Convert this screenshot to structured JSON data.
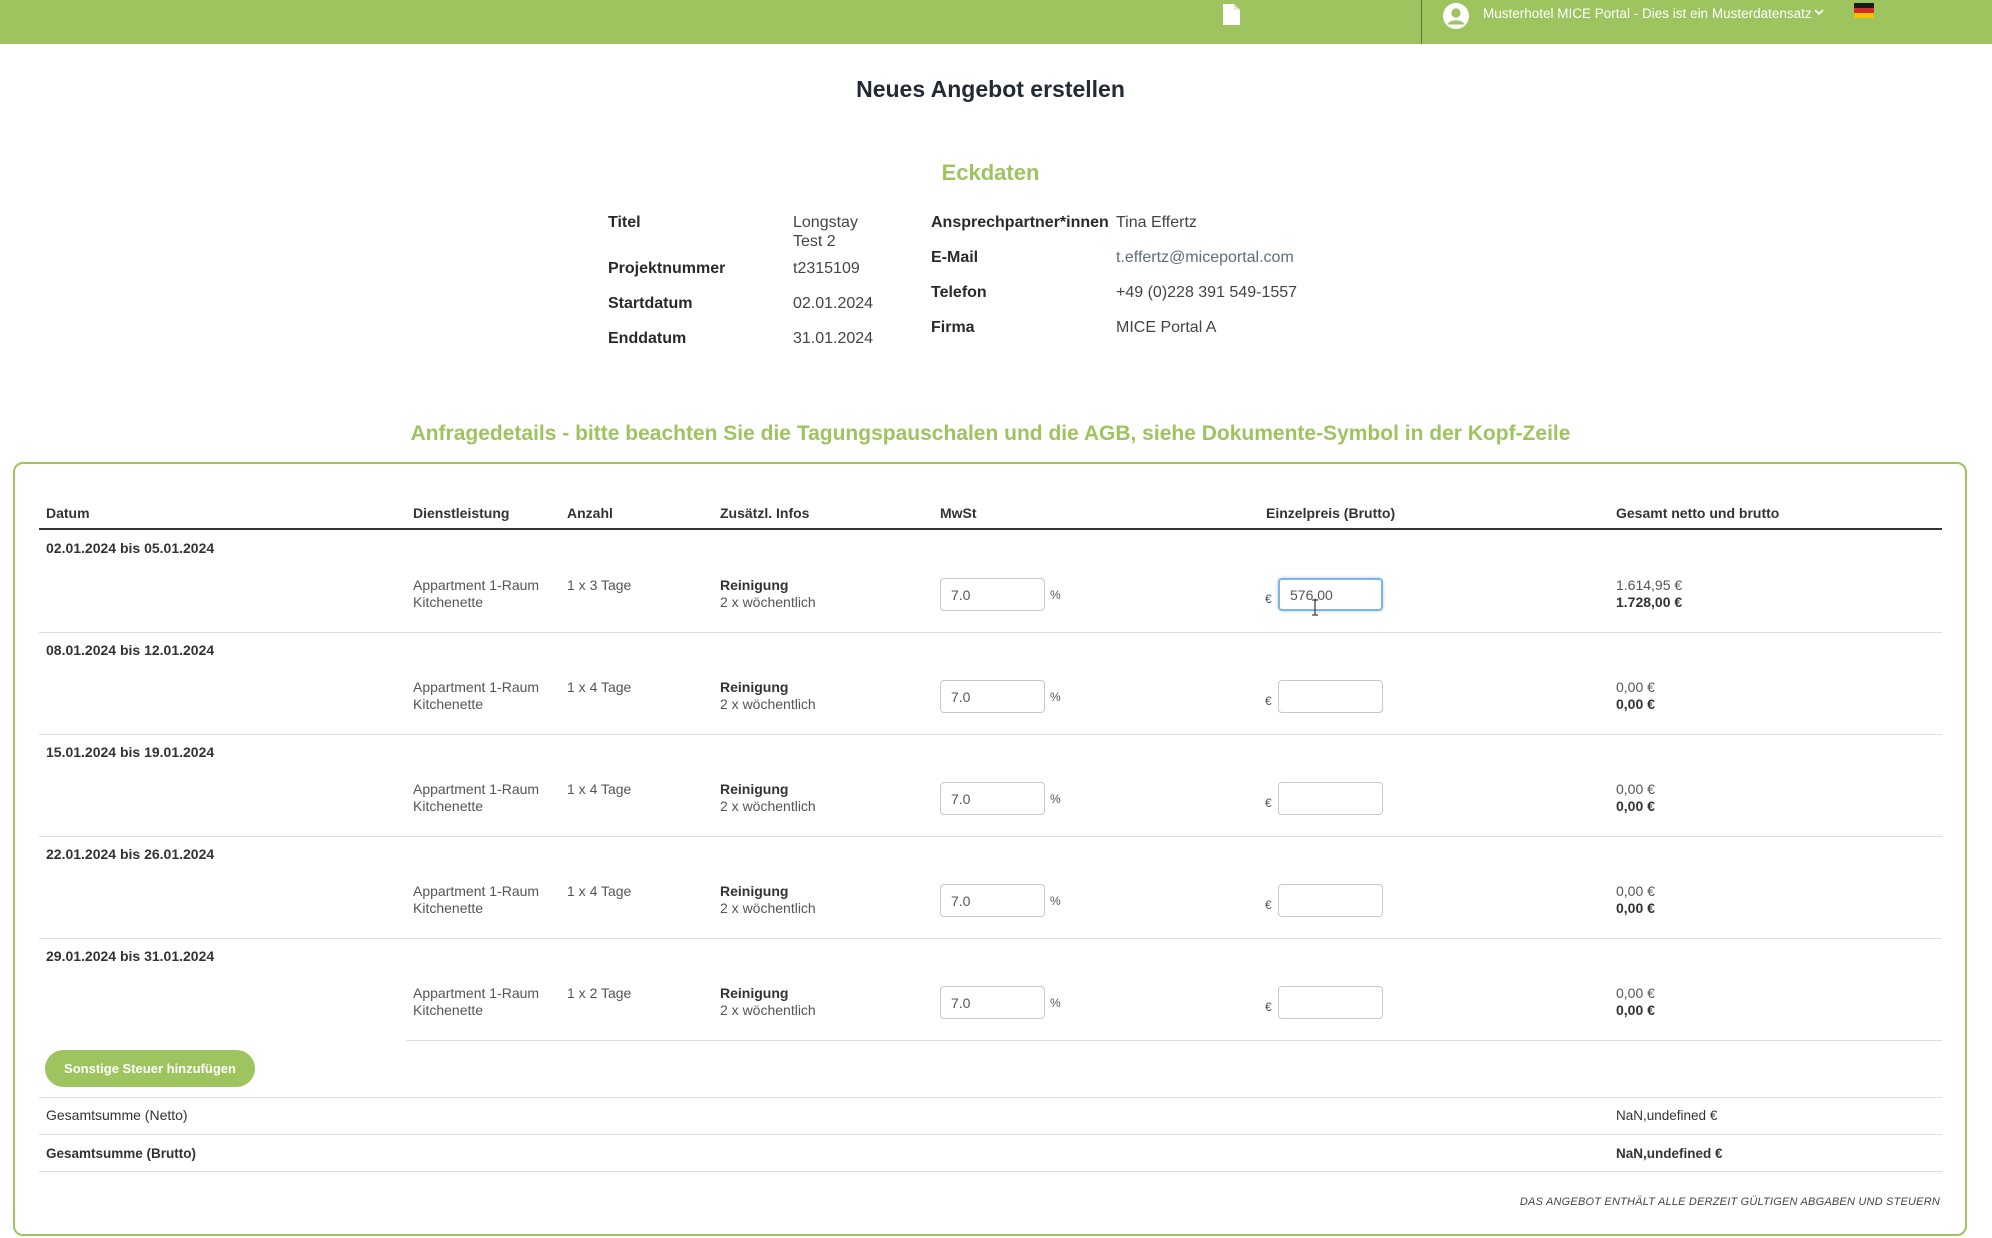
{
  "header": {
    "account_label": "Musterhotel MICE Portal - Dies ist ein Musterdatensatz",
    "icons": {
      "documents": "document-icon",
      "user": "user-circle-icon",
      "menu": "chevron-down-icon",
      "language": "flag-de-icon"
    },
    "colors": {
      "bar": "#9dc45f",
      "accent": "#9dc45f"
    }
  },
  "page_title": "Neues Angebot erstellen",
  "eckdaten": {
    "heading": "Eckdaten",
    "titel_key": "Titel",
    "titel_val_line1": "Longstay",
    "titel_val_line2": "Test 2",
    "projektnummer_key": "Projektnummer",
    "projektnummer_val": "t2315109",
    "startdatum_key": "Startdatum",
    "startdatum_val": "02.01.2024",
    "enddatum_key": "Enddatum",
    "enddatum_val": "31.01.2024",
    "ansprech_key": "Ansprechpartner*innen",
    "ansprech_val": "Tina Effertz",
    "email_key": "E-Mail",
    "email_val": "t.effertz@miceportal.com",
    "telefon_key": "Telefon",
    "telefon_val": "+49 (0)228 391 549-1557",
    "firma_key": "Firma",
    "firma_val": "MICE Portal A"
  },
  "details": {
    "heading": "Anfragedetails - bitte beachten Sie die Tagungspauschalen und die AGB, siehe Dokumente-Symbol in der Kopf-Zeile",
    "columns": {
      "datum": "Datum",
      "dienstleistung": "Dienstleistung",
      "anzahl": "Anzahl",
      "infos": "Zusätzl. Infos",
      "mwst": "MwSt",
      "einzelpreis": "Einzelpreis (Brutto)",
      "gesamt": "Gesamt netto und brutto"
    },
    "percent": "%",
    "currency": "€",
    "rows": [
      {
        "date": "02.01.2024 bis 05.01.2024",
        "service_line1": "Appartment 1-Raum",
        "service_line2": "Kitchenette",
        "count": "1 x 3 Tage",
        "info_title": "Reinigung",
        "info_detail": "2 x wöchentlich",
        "mwst": "7.0",
        "price": "576,00",
        "net": "1.614,95 €",
        "gross": "1.728,00 €"
      },
      {
        "date": "08.01.2024 bis 12.01.2024",
        "service_line1": "Appartment 1-Raum",
        "service_line2": "Kitchenette",
        "count": "1 x 4 Tage",
        "info_title": "Reinigung",
        "info_detail": "2 x wöchentlich",
        "mwst": "7.0",
        "price": "",
        "net": "0,00 €",
        "gross": "0,00 €"
      },
      {
        "date": "15.01.2024 bis 19.01.2024",
        "service_line1": "Appartment 1-Raum",
        "service_line2": "Kitchenette",
        "count": "1 x 4 Tage",
        "info_title": "Reinigung",
        "info_detail": "2 x wöchentlich",
        "mwst": "7.0",
        "price": "",
        "net": "0,00 €",
        "gross": "0,00 €"
      },
      {
        "date": "22.01.2024 bis 26.01.2024",
        "service_line1": "Appartment 1-Raum",
        "service_line2": "Kitchenette",
        "count": "1 x 4 Tage",
        "info_title": "Reinigung",
        "info_detail": "2 x wöchentlich",
        "mwst": "7.0",
        "price": "",
        "net": "0,00 €",
        "gross": "0,00 €"
      },
      {
        "date": "29.01.2024 bis 31.01.2024",
        "service_line1": "Appartment 1-Raum",
        "service_line2": "Kitchenette",
        "count": "1 x 2 Tage",
        "info_title": "Reinigung",
        "info_detail": "2 x wöchentlich",
        "mwst": "7.0",
        "price": "",
        "net": "0,00 €",
        "gross": "0,00 €"
      }
    ],
    "add_tax_button": "Sonstige Steuer hinzufügen",
    "total_net_label": "Gesamtsumme (Netto)",
    "total_net_value": "NaN,undefined €",
    "total_gross_label": "Gesamtsumme (Brutto)",
    "total_gross_value": "NaN,undefined €",
    "footnote": "Das Angebot enthält alle derzeit gültigen Abgaben und Steuern"
  }
}
